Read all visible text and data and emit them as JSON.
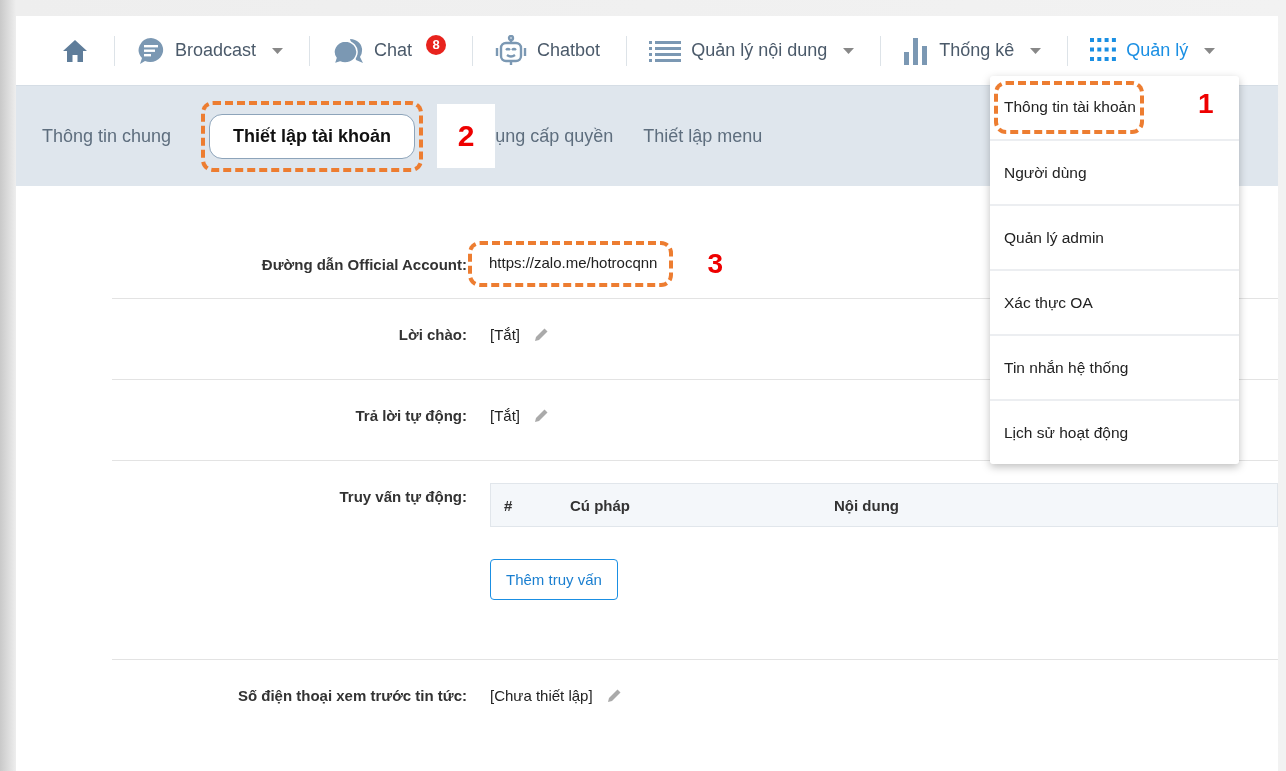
{
  "nav": [
    {
      "kind": "home",
      "selected": false
    },
    {
      "kind": "broadcast",
      "label": "Broadcast",
      "dropdown": true,
      "selected": false
    },
    {
      "kind": "chat",
      "label": "Chat",
      "badge": "8",
      "selected": false
    },
    {
      "kind": "chatbot",
      "label": "Chatbot",
      "selected": false
    },
    {
      "kind": "content",
      "label": "Quản lý nội dung",
      "dropdown": true,
      "selected": false
    },
    {
      "kind": "stats",
      "label": "Thống kê",
      "dropdown": true,
      "selected": false
    },
    {
      "kind": "manage",
      "label": "Quản lý",
      "dropdown": true,
      "selected": true
    }
  ],
  "tabs": [
    {
      "label": "Thông tin chung",
      "selected": false
    },
    {
      "label": "Thiết lập tài khoản",
      "selected": true,
      "callout": "2"
    },
    {
      "label": "ụng cấp quyền",
      "selected": false
    },
    {
      "label": "Thiết lập menu",
      "selected": false
    }
  ],
  "dropdown_menu": {
    "items": [
      {
        "label": "Thông tin tài khoản",
        "callout": "1"
      },
      {
        "label": "Người dùng"
      },
      {
        "label": "Quản lý admin"
      },
      {
        "label": "Xác thực OA"
      },
      {
        "label": "Tin nhắn hệ thống"
      },
      {
        "label": "Lịch sử hoạt động"
      }
    ]
  },
  "settings": [
    {
      "kind": "text",
      "label": "Đường dẫn Official Account:",
      "value": "https://zalo.me/hotrocqnn",
      "callout": "3"
    },
    {
      "kind": "editable",
      "label": "Lời chào:",
      "value": "[Tắt]"
    },
    {
      "kind": "editable",
      "label": "Trả lời tự động:",
      "value": "[Tắt]"
    },
    {
      "kind": "table",
      "label": "Truy vấn tự động:",
      "columns": [
        "#",
        "Cú pháp",
        "Nội dung"
      ],
      "button": "Thêm truy vấn"
    },
    {
      "kind": "editable",
      "label": "Số điện thoại xem trước tin tức:",
      "value": "[Chưa thiết lập]"
    }
  ]
}
